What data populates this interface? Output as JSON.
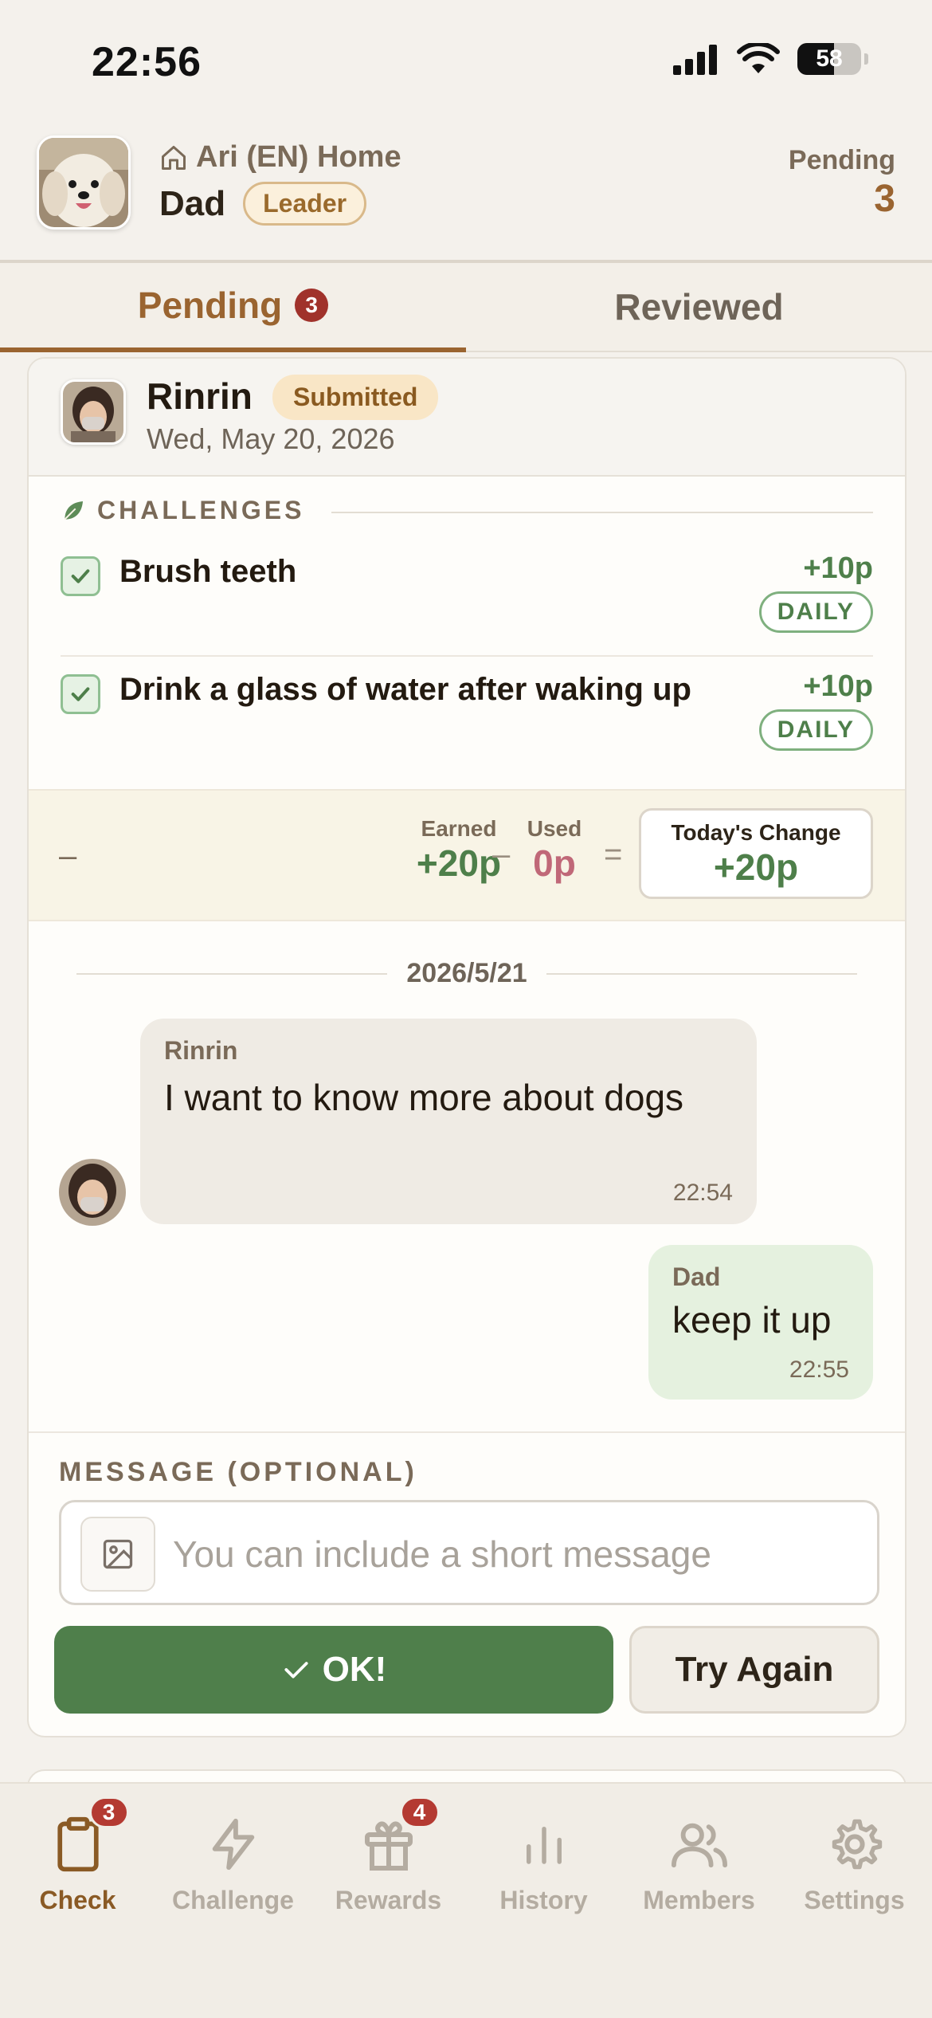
{
  "status_bar": {
    "time": "22:56",
    "battery": "58"
  },
  "header": {
    "home_name": "Ari (EN) Home",
    "user_name": "Dad",
    "role_badge": "Leader",
    "pending_label": "Pending",
    "pending_count": "3"
  },
  "tabs": [
    {
      "label": "Pending",
      "badge": "3",
      "active": true
    },
    {
      "label": "Reviewed",
      "active": false
    }
  ],
  "submission": {
    "kid_name": "Rinrin",
    "status": "Submitted",
    "date": "Wed, May 20, 2026",
    "section_label": "CHALLENGES",
    "challenges": [
      {
        "title": "Brush teeth",
        "points": "+10p",
        "frequency": "DAILY",
        "checked": true
      },
      {
        "title": "Drink a glass of water after waking up",
        "points": "+10p",
        "frequency": "DAILY",
        "checked": true
      }
    ],
    "summary": {
      "dash": "–",
      "earned_label": "Earned",
      "earned_value": "+20p",
      "minus": "–",
      "used_label": "Used",
      "used_value": "0p",
      "equals": "=",
      "today_label": "Today's Change",
      "today_value": "+20p"
    }
  },
  "chat": {
    "date_separator": "2026/5/21",
    "messages": [
      {
        "sender": "Rinrin",
        "text": "I want to know more about dogs",
        "time": "22:54",
        "side": "left"
      },
      {
        "sender": "Dad",
        "text": "keep it up",
        "time": "22:55",
        "side": "right"
      }
    ]
  },
  "message_form": {
    "label": "MESSAGE (OPTIONAL)",
    "placeholder": "You can include a short message",
    "ok_label": "OK!",
    "try_again_label": "Try Again"
  },
  "bottom_nav": [
    {
      "label": "Check",
      "icon": "clipboard-icon",
      "badge": "3",
      "active": true
    },
    {
      "label": "Challenge",
      "icon": "lightning-icon",
      "active": false
    },
    {
      "label": "Rewards",
      "icon": "gift-icon",
      "badge": "4",
      "active": false
    },
    {
      "label": "History",
      "icon": "bar-chart-icon",
      "active": false
    },
    {
      "label": "Members",
      "icon": "users-icon",
      "active": false
    },
    {
      "label": "Settings",
      "icon": "gear-icon",
      "active": false
    }
  ],
  "colors": {
    "accent_brown": "#9a6430",
    "success_green": "#4f7f4b",
    "badge_red": "#b43a32",
    "used_pink": "#c06878"
  }
}
